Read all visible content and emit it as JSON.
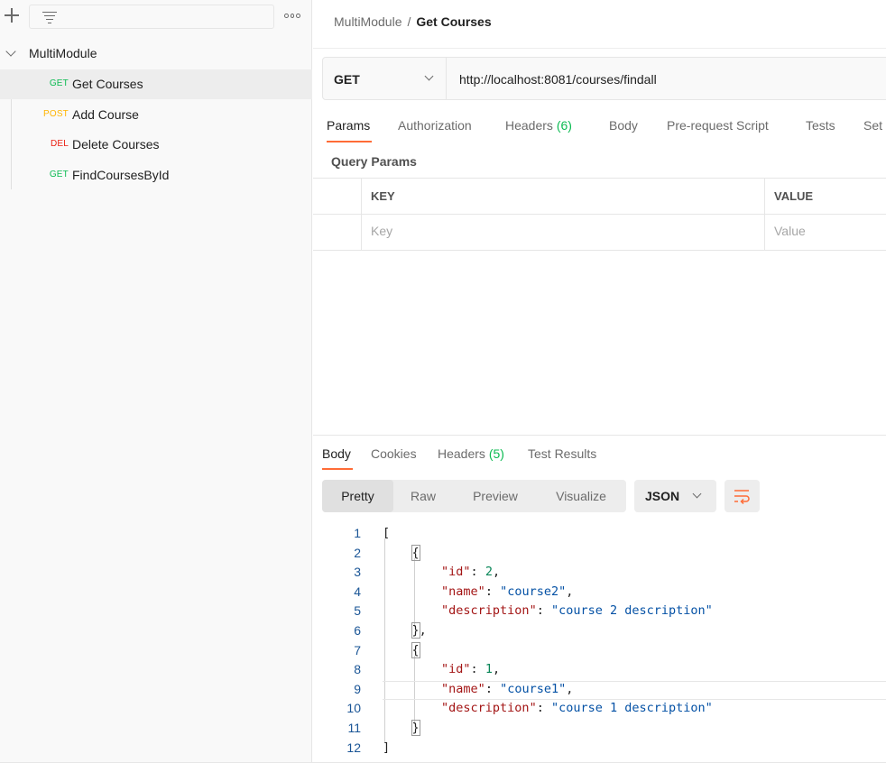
{
  "sidebar": {
    "filter_placeholder": "",
    "collection_name": "MultiModule",
    "requests": [
      {
        "method": "GET",
        "name": "Get Courses"
      },
      {
        "method": "POST",
        "name": "Add Course"
      },
      {
        "method": "DEL",
        "name": "Delete Courses"
      },
      {
        "method": "GET",
        "name": "FindCoursesById"
      }
    ]
  },
  "breadcrumb": {
    "parent": "MultiModule",
    "separator": "/",
    "current": "Get Courses"
  },
  "request": {
    "method": "GET",
    "url": "http://localhost:8081/courses/findall"
  },
  "request_tabs": {
    "params": "Params",
    "authorization": "Authorization",
    "headers": "Headers",
    "headers_count": "(6)",
    "body": "Body",
    "prerequest": "Pre-request Script",
    "tests": "Tests",
    "settings": "Set"
  },
  "query_params": {
    "title": "Query Params",
    "key_header": "KEY",
    "value_header": "VALUE",
    "key_placeholder": "Key",
    "value_placeholder": "Value"
  },
  "response_tabs": {
    "body": "Body",
    "cookies": "Cookies",
    "headers": "Headers",
    "headers_count": "(5)",
    "test_results": "Test Results"
  },
  "view_modes": {
    "pretty": "Pretty",
    "raw": "Raw",
    "preview": "Preview",
    "visualize": "Visualize"
  },
  "format": "JSON",
  "code_lines": [
    {
      "n": "1"
    },
    {
      "n": "2"
    },
    {
      "n": "3"
    },
    {
      "n": "4"
    },
    {
      "n": "5"
    },
    {
      "n": "6"
    },
    {
      "n": "7"
    },
    {
      "n": "8"
    },
    {
      "n": "9"
    },
    {
      "n": "10"
    },
    {
      "n": "11"
    },
    {
      "n": "12"
    }
  ],
  "response_json": [
    {
      "id": 2,
      "name": "course2",
      "description": "course 2 description"
    },
    {
      "id": 1,
      "name": "course1",
      "description": "course 1 description"
    }
  ],
  "json_keys": {
    "id": "\"id\"",
    "name": "\"name\"",
    "description": "\"description\""
  },
  "json_values": {
    "id1": "2",
    "name1": "\"course2\"",
    "desc1": "\"course 2 description\"",
    "id2": "1",
    "name2": "\"course1\"",
    "desc2": "\"course 1 description\""
  },
  "colors": {
    "accent": "#ff6c37",
    "get": "#0cbb52",
    "post": "#ffb400",
    "del": "#eb2013"
  }
}
